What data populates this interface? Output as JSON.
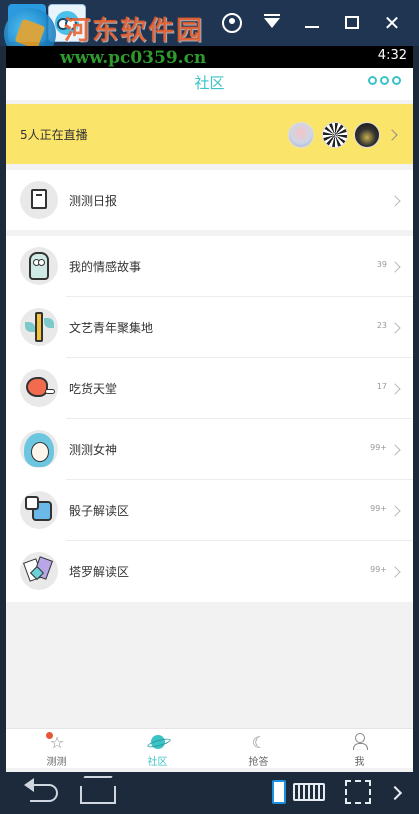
{
  "watermark": {
    "title": "河东软件园",
    "url": "www.pc0359.cn"
  },
  "status_bar": {
    "time": "4:32"
  },
  "header": {
    "title": "社区",
    "more_icon": "more-dots-icon"
  },
  "live_banner": {
    "text": "5人正在直播"
  },
  "daily": {
    "label": "测测日报",
    "icon": "book-icon"
  },
  "topics": [
    {
      "label": "我的情感故事",
      "count": "39",
      "icon": "owl-icon"
    },
    {
      "label": "文艺青年聚集地",
      "count": "23",
      "icon": "pencil-leaf-icon"
    },
    {
      "label": "吃货天堂",
      "count": "17",
      "icon": "ham-icon"
    },
    {
      "label": "测测女神",
      "count": "99+",
      "icon": "goddess-icon"
    },
    {
      "label": "骰子解读区",
      "count": "99+",
      "icon": "dice-icon"
    },
    {
      "label": "塔罗解读区",
      "count": "99+",
      "icon": "tarot-cards-icon"
    }
  ],
  "tabbar": {
    "tabs": [
      {
        "label": "测测",
        "icon": "star-icon"
      },
      {
        "label": "社区",
        "icon": "planet-icon",
        "active": true
      },
      {
        "label": "抢答",
        "icon": "moon-icon"
      },
      {
        "label": "我",
        "icon": "person-icon"
      }
    ]
  },
  "colors": {
    "accent": "#3cc3c7",
    "banner": "#fbe46a",
    "badge": "#e8563a"
  }
}
